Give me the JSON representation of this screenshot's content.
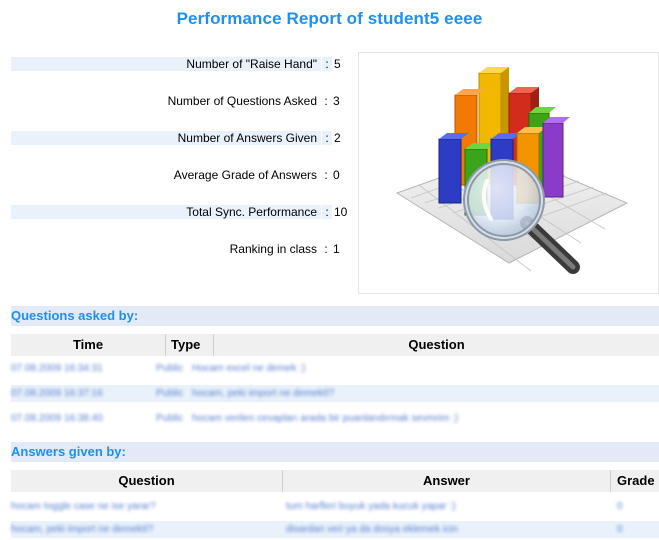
{
  "report": {
    "title": "Performance Report of student5 eeee",
    "stats": [
      {
        "label": "Number of \"Raise Hand\"",
        "value": "5"
      },
      {
        "label": "Number of Questions Asked",
        "value": "3"
      },
      {
        "label": "Number of Answers Given",
        "value": "2"
      },
      {
        "label": "Average Grade of Answers",
        "value": "0"
      },
      {
        "label": "Total Sync. Performance",
        "value": "10"
      },
      {
        "label": "Ranking in class",
        "value": "1"
      }
    ],
    "separator": ":"
  },
  "questions": {
    "header": "Questions asked by:",
    "columns": [
      "Time",
      "Type",
      "Question"
    ],
    "rows": [
      {
        "time": "07.08.2009 16:34:31",
        "type": "Public",
        "question": "Hocam excel ne demek :)"
      },
      {
        "time": "07.08.2009 16:37:16",
        "type": "Public",
        "question": "hocam, peki import ne demektİ?"
      },
      {
        "time": "07.08.2009 16:38:40",
        "type": "Public",
        "question": "hocam verilen cevapları arada bir puanlandırmak sevmrim :)"
      }
    ]
  },
  "answers": {
    "header": "Answers given by:",
    "columns": [
      "Question",
      "Answer",
      "Grade"
    ],
    "rows": [
      {
        "question": "hocam toggle case ne ise yarar?",
        "answer": "tum harfleri buyuk yada kucuk yapar :)",
        "grade": "0"
      },
      {
        "question": "hocam, peki import ne demektİ?",
        "answer": "disardan veri ya da dosya eklemek icin",
        "grade": "0"
      }
    ]
  },
  "colors": {
    "title": "#1e90ee",
    "section_bg": "#e3eaf7",
    "row_shade": "#e9f2fb"
  },
  "image": {
    "icon": "chart-magnifier-icon"
  }
}
